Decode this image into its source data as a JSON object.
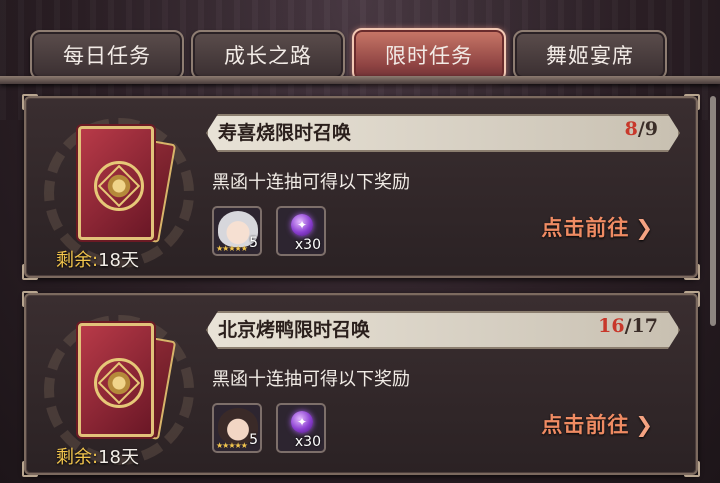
{
  "tabs": [
    {
      "label": "每日任务",
      "active": false
    },
    {
      "label": "成长之路",
      "active": false
    },
    {
      "label": "限时任务",
      "active": true
    },
    {
      "label": "舞姬宴席",
      "active": false
    }
  ],
  "colors": {
    "accent_red": "#c8382b",
    "goto_orange": "#ef8b63",
    "remain_gold": "#f3c64d"
  },
  "tasks": [
    {
      "title": "寿喜烧限时召唤",
      "progress_current": "8",
      "progress_total": "/9",
      "description": "黑函十连抽可得以下奖励",
      "remain_label": "剩余:",
      "remain_value": "18天",
      "reward_hero_level": "5",
      "reward_item_qty": "x30",
      "goto_label": "点击前往",
      "chevron_icon": "chevron-right-icon"
    },
    {
      "title": "北京烤鸭限时召唤",
      "progress_current": "16",
      "progress_total": "/17",
      "description": "黑函十连抽可得以下奖励",
      "remain_label": "剩余:",
      "remain_value": "18天",
      "reward_hero_level": "5",
      "reward_item_qty": "x30",
      "goto_label": "点击前往",
      "chevron_icon": "chevron-right-icon"
    }
  ]
}
